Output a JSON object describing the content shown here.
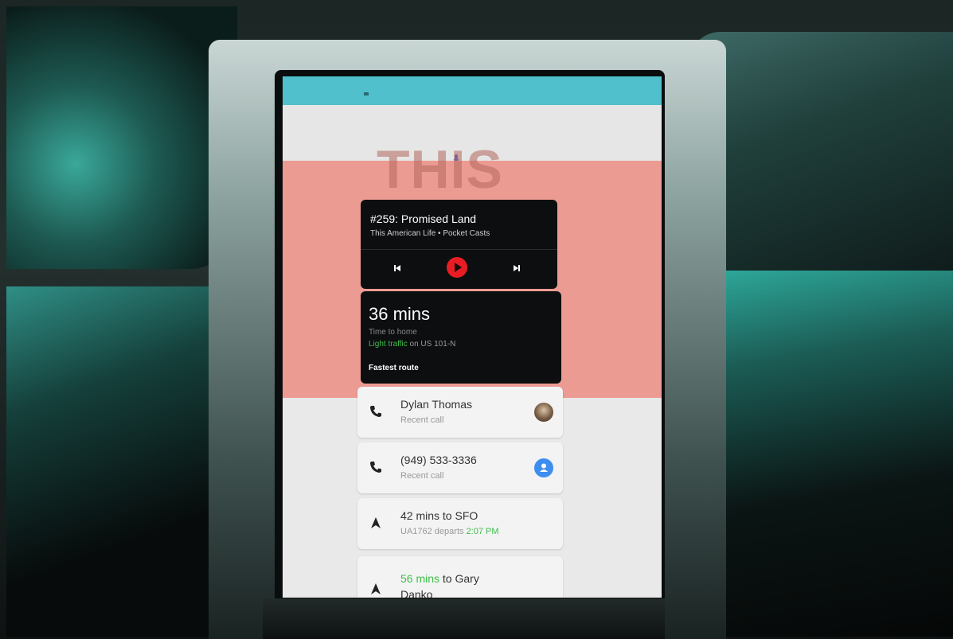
{
  "media": {
    "title": "#259: Promised Land",
    "subtitle": "This American Life • Pocket Casts",
    "artwork_text": "THIS AMER"
  },
  "navigation": {
    "eta": "36 mins",
    "label": "Time to home",
    "traffic_status": "Light traffic",
    "traffic_road": " on US 101-N",
    "route": "Fastest route"
  },
  "contacts": [
    {
      "name": "Dylan Thomas",
      "detail": "Recent call",
      "icon": "phone-icon",
      "avatar": "photo"
    },
    {
      "name": "(949) 533-3336",
      "detail": "Recent call",
      "icon": "phone-icon",
      "avatar": "contact-badge"
    }
  ],
  "trips": [
    {
      "title": "42 mins to SFO",
      "detail_prefix": "UA1762 departs ",
      "detail_time": "2:07 PM",
      "icon": "navigation-arrow-icon"
    },
    {
      "title_highlight": "56 mins",
      "title_rest": " to Gary",
      "title_line2": "Danko",
      "icon": "navigation-arrow-icon"
    }
  ],
  "colors": {
    "play_button": "#e81d24",
    "status_green": "#3fbf4a",
    "status_bar": "#4fc0cc",
    "artwork_band": "#ec9b92",
    "contact_badge": "#3d8ef0"
  }
}
